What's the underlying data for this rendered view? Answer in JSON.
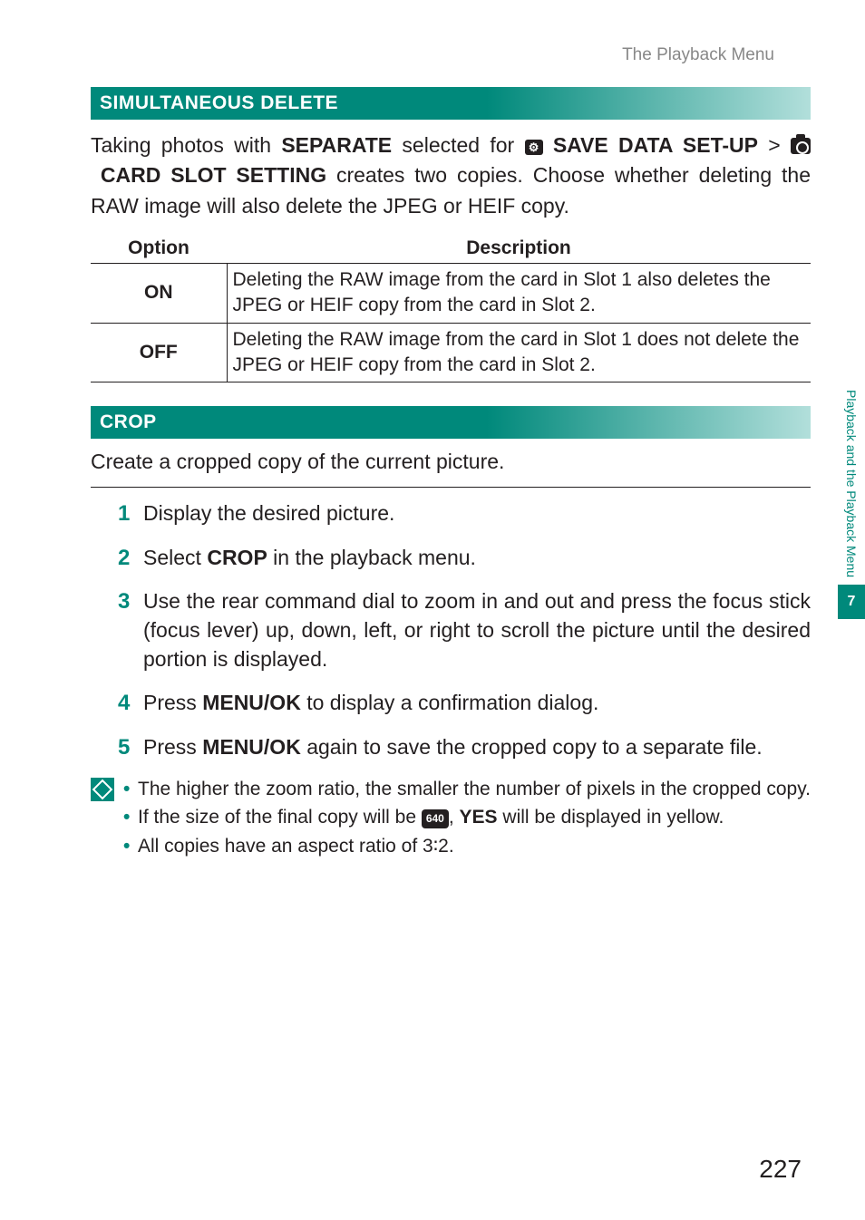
{
  "header": "The Playback Menu",
  "section1": {
    "title": "SIMULTANEOUS DELETE",
    "body_pre": "Taking photos with ",
    "body_separate": "SEPARATE",
    "body_mid1": " selected for ",
    "save_data_setup": "SAVE DATA SET-UP",
    "gt": " > ",
    "card_slot": "CARD SLOT SETTING",
    "body_post": " creates two copies. Choose whether deleting the RAW image will also delete the JPEG or HEIF copy.",
    "table": {
      "col1": "Option",
      "col2": "Description",
      "rows": [
        {
          "opt": "ON",
          "desc": "Deleting the RAW image from the card in Slot 1 also deletes the JPEG or HEIF copy from the card in Slot 2."
        },
        {
          "opt": "OFF",
          "desc": "Deleting the RAW image from the card in Slot 1 does not delete the JPEG or HEIF copy from the card in Slot 2."
        }
      ]
    }
  },
  "section2": {
    "title": "CROP",
    "intro": "Create a cropped copy of the current picture.",
    "steps": [
      {
        "n": "1",
        "text": "Display the desired picture."
      },
      {
        "n": "2",
        "pre": "Select ",
        "bold": "CROP",
        "post": " in the playback menu."
      },
      {
        "n": "3",
        "text": "Use the rear command dial to zoom in and out and press the focus stick (focus lever) up, down, left, or right to scroll the picture until the desired portion is displayed."
      },
      {
        "n": "4",
        "pre": "Press ",
        "bold": "MENU/OK",
        "post": " to display a confirmation dialog."
      },
      {
        "n": "5",
        "pre": "Press ",
        "bold": "MENU/OK",
        "post": " again to save the cropped copy to a separate file."
      }
    ],
    "notes": [
      {
        "text": "The higher the zoom ratio, the smaller the number of pixels in the cropped copy."
      },
      {
        "pre": "If the size of the final copy will be ",
        "badge": "640",
        "mid": ", ",
        "bold": "YES",
        "post": " will be displayed in yellow."
      },
      {
        "text": "All copies have an aspect ratio of 3∶2."
      }
    ]
  },
  "sidebar": {
    "label": "Playback and the Playback Menu",
    "chapter": "7"
  },
  "page_number": "227"
}
